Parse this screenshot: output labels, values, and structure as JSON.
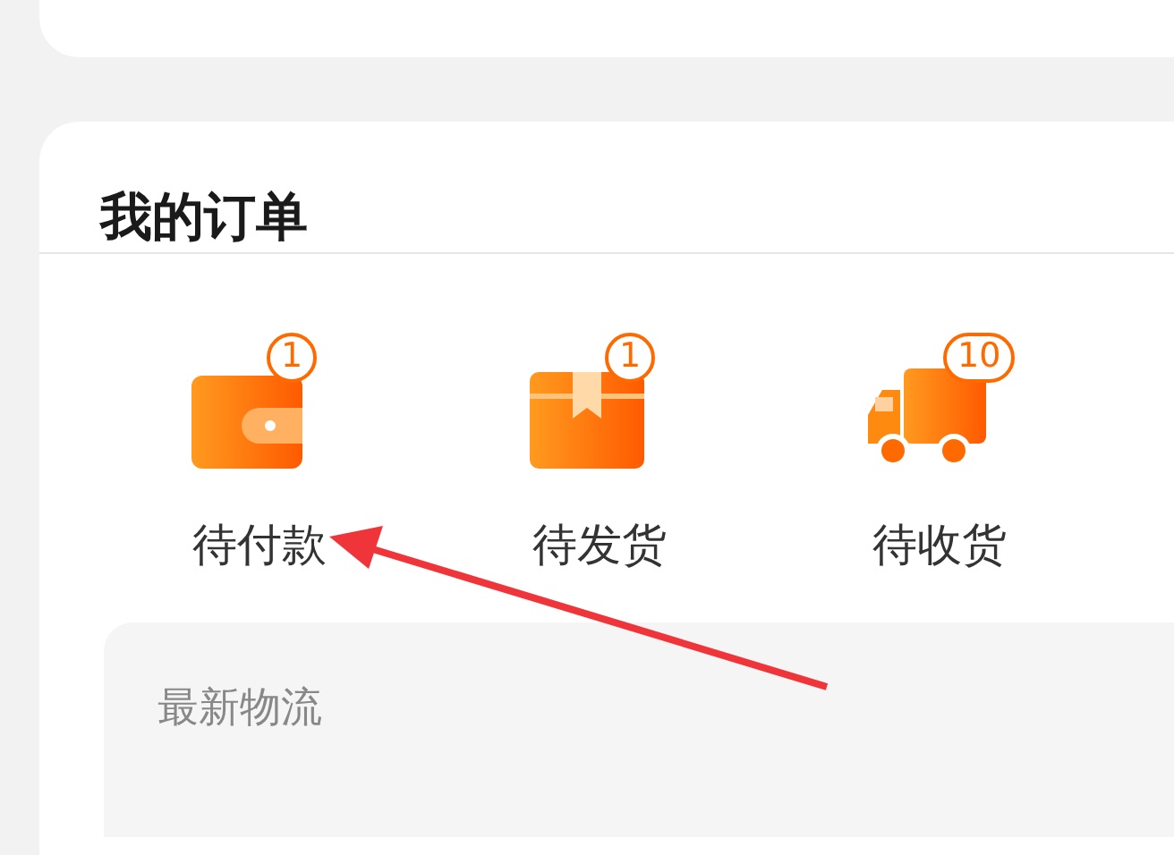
{
  "orders": {
    "title": "我的订单",
    "items": [
      {
        "kind": "wallet",
        "label": "待付款",
        "badge": "1"
      },
      {
        "kind": "box",
        "label": "待发货",
        "badge": "1"
      },
      {
        "kind": "truck",
        "label": "待收货",
        "badge": "10"
      }
    ]
  },
  "logistics": {
    "title": "最新物流"
  }
}
